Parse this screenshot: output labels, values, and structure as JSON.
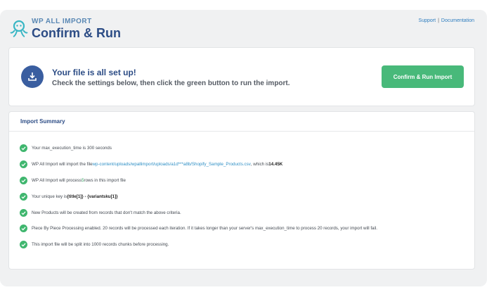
{
  "brand": {
    "sub": "WP ALL IMPORT",
    "title": "Confirm & Run"
  },
  "top_links": {
    "support": "Support",
    "separator": "|",
    "documentation": "Documentation"
  },
  "setup": {
    "title": "Your file is all set up!",
    "description": "Check the settings below, then click the green button to run the import.",
    "button_label": "Confirm & Run Import"
  },
  "summary": {
    "title": "Import Summary",
    "items": [
      {
        "text": "Your max_execution_time is 300 seconds"
      },
      {
        "prefix": "WP All Import will import the file ",
        "link": "wp-content/uploads/wpallimport/uploads/a1d***a8b/Shopify_Sample_Products.csv",
        "middle": ", which is ",
        "size": "14.45K"
      },
      {
        "prefix": "WP All Import will process ",
        "count": "5",
        "suffix": " rows in this import file"
      },
      {
        "prefix": "Your unique key is ",
        "key": "{title[1]} - {variantsku[1]}"
      },
      {
        "text": "New Products will be created from records that don't match the above criteria."
      },
      {
        "text": "Piece By Piece Processing enabled. 20 records will be processed each iteration. If it takes longer than your server's max_execution_time to process 20 records, your import will fail."
      },
      {
        "text": "This import file will be split into 1000 records chunks before processing."
      }
    ]
  },
  "colors": {
    "brand_blue": "#2c4c85",
    "button_green": "#48b97a",
    "check_green": "#3fb66e",
    "link_blue": "#2e8fc5"
  }
}
